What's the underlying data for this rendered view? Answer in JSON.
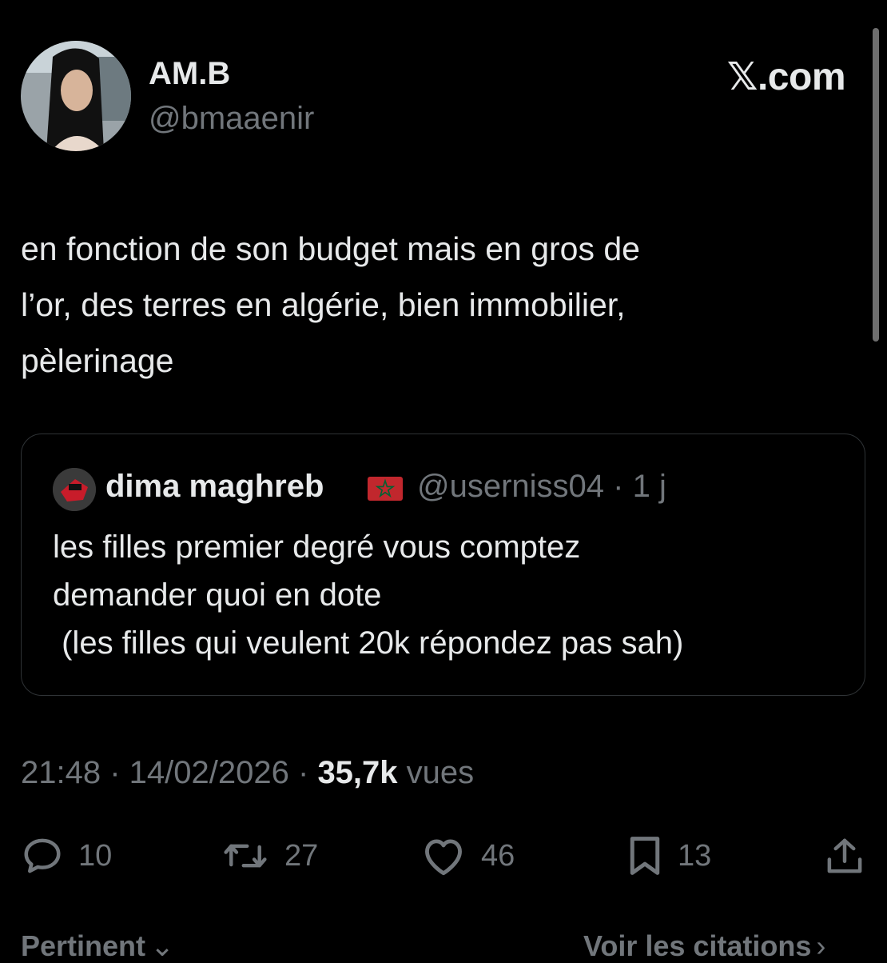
{
  "author": {
    "name": "AM.B",
    "handle": "@bmaaenir",
    "avatar_icon": "profile-photo"
  },
  "brand": "𝕏.com",
  "tweet_text": "en fonction de son budget mais en gros de\nl’or, des terres en algérie, bien immobilier,\npèlerinage",
  "quote": {
    "name": "dima maghreb",
    "flag_icon": "morocco-flag",
    "handle": "@userniss04",
    "time": "1 j",
    "text": "les filles premier degré vous comptez\ndemander quoi en dote\n (les filles qui veulent 20k répondez pas sah)"
  },
  "meta": {
    "time": "21:48",
    "date": "14/02/2026",
    "views_count": "35,7k",
    "views_label": "vues"
  },
  "actions": {
    "reply": "10",
    "repost": "27",
    "like": "46",
    "bookmark": "13"
  },
  "footer": {
    "sort_label": "Pertinent",
    "quotes_label": "Voir les citations"
  },
  "colors": {
    "background": "#000000",
    "text": "#e7e9ea",
    "muted": "#71767b",
    "border": "#2f3336"
  }
}
